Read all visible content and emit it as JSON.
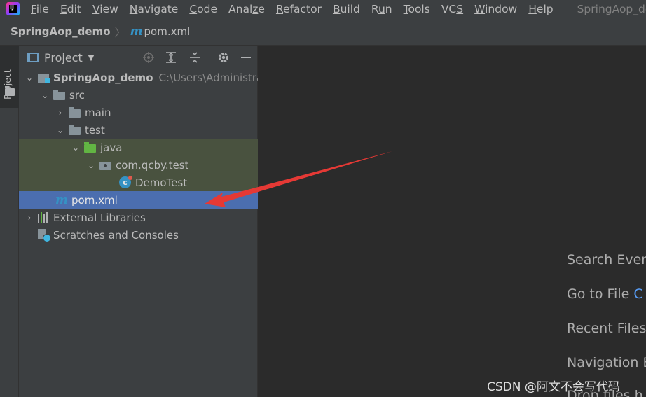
{
  "menu": {
    "items": [
      "File",
      "Edit",
      "View",
      "Navigate",
      "Code",
      "Analyze",
      "Refactor",
      "Build",
      "Run",
      "Tools",
      "VCS",
      "Window",
      "Help"
    ],
    "mnemonics": [
      "F",
      "E",
      "V",
      "N",
      "C",
      "z",
      "R",
      "B",
      "u",
      "T",
      "S",
      "W",
      "H"
    ],
    "window_title": "SpringAop_dem"
  },
  "breadcrumb": {
    "project": "SpringAop_demo",
    "file": "pom.xml",
    "file_icon": "m"
  },
  "toolstrip": {
    "project_tab": "Project"
  },
  "project_panel": {
    "title": "Project"
  },
  "tree": {
    "project": {
      "name": "SpringAop_demo",
      "path": "C:\\Users\\Administrat"
    },
    "src": "src",
    "main": "main",
    "test": "test",
    "java": "java",
    "package": "com.qcby.test",
    "class": "DemoTest",
    "class_icon": "c",
    "pom": "pom.xml",
    "pom_icon": "m",
    "external": "External Libraries",
    "scratches": "Scratches and Consoles"
  },
  "editor_hints": {
    "search": "Search Every",
    "goto_file": "Go to File",
    "goto_shortcut": "C",
    "recent": "Recent Files",
    "navigation": "Navigation B",
    "drop": "Drop files h"
  },
  "watermark": "CSDN @阿文不会写代码",
  "colors": {
    "background": "#2b2b2b",
    "chrome": "#3c3f41",
    "selection": "#4b6eaf",
    "test_highlight": "#49523f",
    "annotation_arrow": "#e53935"
  }
}
